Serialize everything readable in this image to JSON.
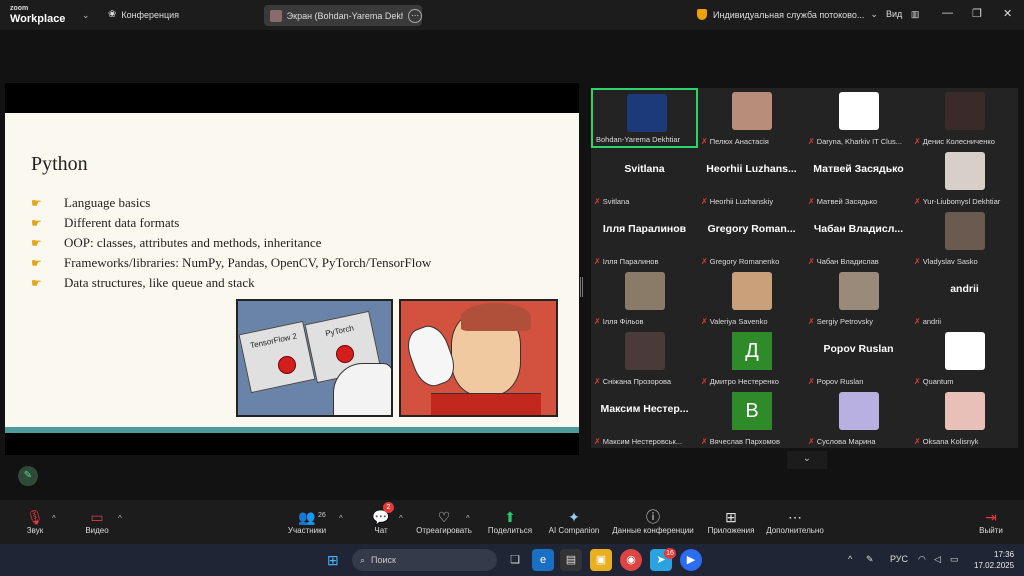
{
  "app": {
    "logo_top": "zoom",
    "logo_bottom": "Workplace"
  },
  "topbar": {
    "conference_label": "Конференция",
    "screen_label": "Экран (Bohdan-Yarema Dekhtiar)",
    "stream_label": "Индивидуальная служба потоково...",
    "view_label": "Вид"
  },
  "slide": {
    "title": "Python",
    "bullets": [
      "Language basics",
      "Different data formats",
      "OOP: classes, attributes and methods, inheritance",
      "Frameworks/libraries: NumPy, Pandas, OpenCV, PyTorch/TensorFlow",
      "Data structures, like queue and stack"
    ],
    "meme_button_left": "TensorFlow 2",
    "meme_button_right": "PyTorch"
  },
  "participants": [
    {
      "name": "Bohdan-Yarema Dekhtiar",
      "big": "",
      "kind": "video",
      "color": "#1c3a7a",
      "active": true,
      "muted": false
    },
    {
      "name": "Пелюх Анастасія",
      "big": "",
      "kind": "video",
      "color": "#b88d7a",
      "active": false,
      "muted": true
    },
    {
      "name": "Daryna, Kharkiv IT Clus...",
      "big": "",
      "kind": "logo",
      "color": "#ffffff",
      "active": false,
      "muted": true
    },
    {
      "name": "Денис Колесниченко",
      "big": "",
      "kind": "video",
      "color": "#3a2a2a",
      "active": false,
      "muted": true
    },
    {
      "name": "Svitlana",
      "big": "Svitlana",
      "kind": "text",
      "color": "",
      "active": false,
      "muted": true
    },
    {
      "name": "Heorhii Luzhanskiy",
      "big": "Heorhii Luzhans...",
      "kind": "text",
      "color": "",
      "active": false,
      "muted": true
    },
    {
      "name": "Матвей Засядько",
      "big": "Матвей Засядько",
      "kind": "text",
      "color": "",
      "active": false,
      "muted": true
    },
    {
      "name": "Yur-Liubomysl Dekhtiar",
      "big": "",
      "kind": "video",
      "color": "#d8d0c8",
      "active": false,
      "muted": true
    },
    {
      "name": "Ілля Паралинов",
      "big": "Ілля Паралинов",
      "kind": "text",
      "color": "",
      "active": false,
      "muted": true
    },
    {
      "name": "Gregory Romanenko",
      "big": "Gregory Roman...",
      "kind": "text",
      "color": "",
      "active": false,
      "muted": true
    },
    {
      "name": "Чабан Владислав",
      "big": "Чабан Владисл...",
      "kind": "text",
      "color": "",
      "active": false,
      "muted": true
    },
    {
      "name": "Vladyslav Sasko",
      "big": "",
      "kind": "video",
      "color": "#6a5a50",
      "active": false,
      "muted": true
    },
    {
      "name": "Ілля Фільов",
      "big": "",
      "kind": "video",
      "color": "#8a7a68",
      "active": false,
      "muted": true
    },
    {
      "name": "Valeriya Savenko",
      "big": "",
      "kind": "video",
      "color": "#c9a07a",
      "active": false,
      "muted": true
    },
    {
      "name": "Sergiy Petrovsky",
      "big": "",
      "kind": "video",
      "color": "#9a8a7a",
      "active": false,
      "muted": true
    },
    {
      "name": "andrii",
      "big": "andrii",
      "kind": "text",
      "color": "",
      "active": false,
      "muted": true
    },
    {
      "name": "Сніжана Прозорова",
      "big": "",
      "kind": "video",
      "color": "#4a3a3a",
      "active": false,
      "muted": true
    },
    {
      "name": "Дмитро Нестеренко",
      "big": "Д",
      "kind": "letter",
      "color": "#2f8a2a",
      "active": false,
      "muted": true
    },
    {
      "name": "Popov Ruslan",
      "big": "Popov Ruslan",
      "kind": "text",
      "color": "",
      "active": false,
      "muted": true
    },
    {
      "name": "Quantum",
      "big": "",
      "kind": "logo",
      "color": "#ffffff",
      "active": false,
      "muted": true
    },
    {
      "name": "Максим Нестеровськ...",
      "big": "Максим Нестер...",
      "kind": "text",
      "color": "",
      "active": false,
      "muted": true
    },
    {
      "name": "Вячеслав Пархомов",
      "big": "В",
      "kind": "letter",
      "color": "#2f8a2a",
      "active": false,
      "muted": true
    },
    {
      "name": "Суслова Марина",
      "big": "",
      "kind": "video",
      "color": "#b8b0e0",
      "active": false,
      "muted": true
    },
    {
      "name": "Oksana Kolisnyk",
      "big": "",
      "kind": "video",
      "color": "#e8c0b8",
      "active": false,
      "muted": true
    }
  ],
  "toolbar": {
    "audio": "Звук",
    "video": "Видео",
    "participants": "Участники",
    "participants_count": "26",
    "chat": "Чат",
    "chat_badge": "2",
    "react": "Отреагировать",
    "share": "Поделиться",
    "ai": "AI Companion",
    "meeting_info": "Данные конференции",
    "apps": "Приложения",
    "more": "Дополнительно",
    "leave": "Выйти"
  },
  "taskbar": {
    "search_placeholder": "Поиск",
    "telegram_badge": "16",
    "lang": "РУС",
    "time": "17:36",
    "date": "17.02.2025"
  }
}
